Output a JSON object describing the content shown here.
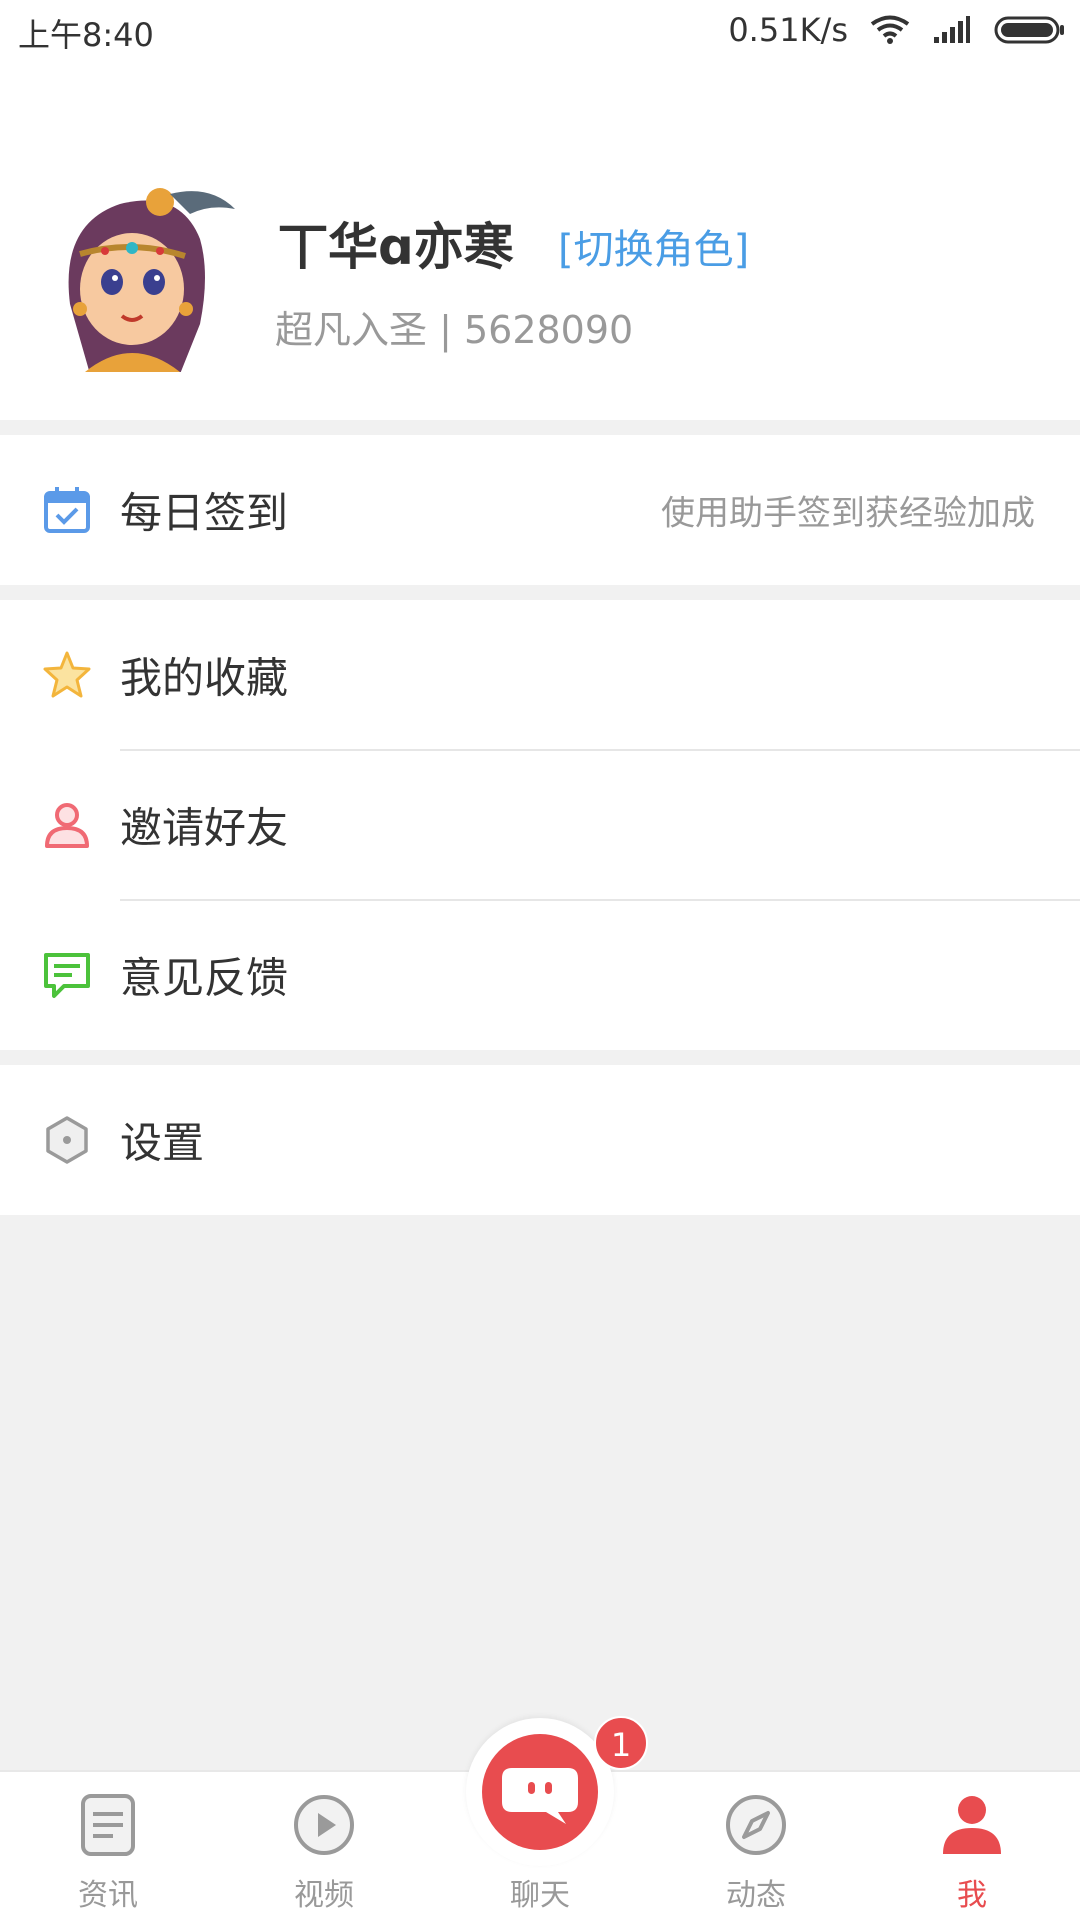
{
  "status_bar": {
    "time": "上午8:40",
    "net_speed": "0.51K/s",
    "icons": [
      "wifi-icon",
      "signal-icon",
      "battery-icon"
    ]
  },
  "profile": {
    "username": "丅华ɑ亦寒",
    "switch_role": "[切换角色]",
    "level_line": "超凡入圣 | 5628090",
    "avatar": "character-avatar"
  },
  "menu": {
    "checkin": {
      "label": "每日签到",
      "hint": "使用助手签到获经验加成",
      "icon": "calendar-check-icon"
    },
    "favorites": {
      "label": "我的收藏",
      "icon": "star-icon"
    },
    "invite": {
      "label": "邀请好友",
      "icon": "person-icon"
    },
    "feedback": {
      "label": "意见反馈",
      "icon": "message-icon"
    },
    "settings": {
      "label": "设置",
      "icon": "hexagon-settings-icon"
    }
  },
  "tabbar": {
    "tabs": [
      {
        "label": "资讯",
        "icon": "document-icon"
      },
      {
        "label": "视频",
        "icon": "play-icon"
      },
      {
        "label": "聊天",
        "icon": "chat-icon"
      },
      {
        "label": "动态",
        "icon": "compass-icon"
      },
      {
        "label": "我",
        "icon": "person-icon"
      }
    ],
    "active": "我",
    "chat_badge": "1"
  },
  "colors": {
    "accent_red": "#e84c4f",
    "link_blue": "#4a9de5",
    "icon_blue": "#5b9ae8",
    "icon_gold": "#f3b53c",
    "icon_pink": "#f06a74",
    "icon_green": "#4cc23b",
    "icon_gray": "#9a9a9a"
  }
}
